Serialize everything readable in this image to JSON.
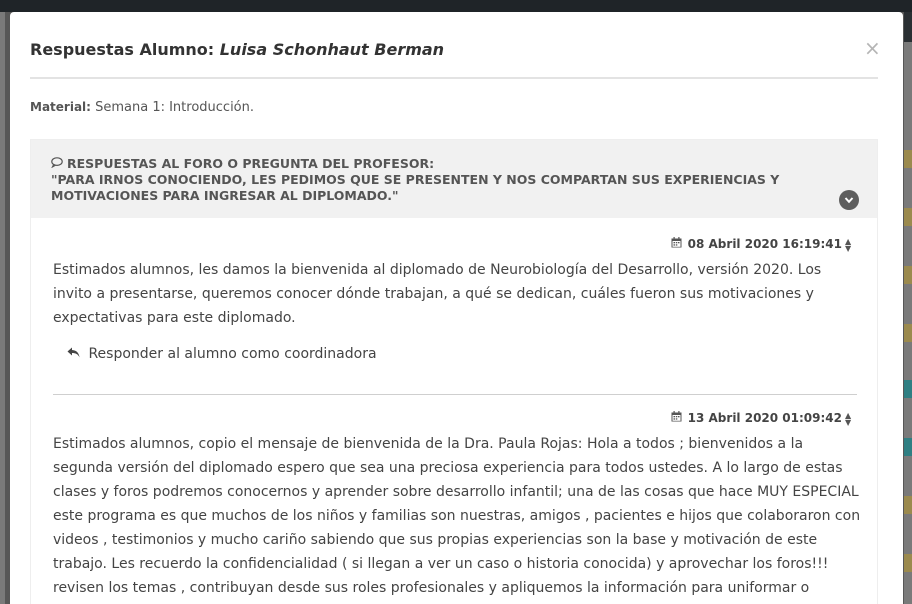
{
  "modal": {
    "title_prefix": "Respuestas Alumno: ",
    "student_name": "Luisa Schonhaut Berman",
    "close_label": "×",
    "material_label": "Material:",
    "material_value": " Semana 1: Introducción."
  },
  "forum": {
    "heading": "Respuestas al foro o pregunta del profesor:",
    "question": "\"Para irnos conociendo, les pedimos que se presenten y nos compartan sus experiencias y motivaciones para ingresar al diplomado.\""
  },
  "posts": [
    {
      "date": "08 Abril 2020 16:19:41",
      "text": "Estimados alumnos, les damos la bienvenida al diplomado de Neurobiología del Desarrollo, versión 2020. Los invito a presentarse, queremos conocer dónde trabajan, a qué se dedican, cuáles fueron sus motivaciones y expectativas para este diplomado.",
      "reply_label": "Responder al alumno como coordinadora"
    },
    {
      "date": "13 Abril 2020 01:09:42",
      "text": "Estimados alumnos, copio el mensaje de bienvenida de la Dra. Paula Rojas: Hola a todos ; bienvenidos a la segunda versión del diplomado espero que sea una preciosa experiencia para todos ustedes. A lo largo de estas clases y foros podremos conocernos y aprender sobre desarrollo infantil; una de las cosas que hace MUY ESPECIAL este programa es que muchos de los niños y familias son nuestras, amigos , pacientes e hijos que colaboraron con videos , testimonios y mucho cariño sabiendo que sus propias experiencias son la base y motivación de este trabajo. Les recuerdo la confidencialidad ( si llegan a ver un caso o historia conocida) y aprovechar los foros!!! revisen los temas , contribuyan desde sus roles profesionales y apliquemos la información para uniformar o generar conocimiento. \" no olviden las"
    }
  ],
  "icons": {
    "comment": "comment-icon",
    "chevron": "chevron-down-circle-icon",
    "calendar": "calendar-icon",
    "reply": "reply-icon",
    "close": "close-icon"
  },
  "colors": {
    "overlay": "#575757",
    "card_header_bg": "#f1f1f1",
    "text": "#444444"
  }
}
